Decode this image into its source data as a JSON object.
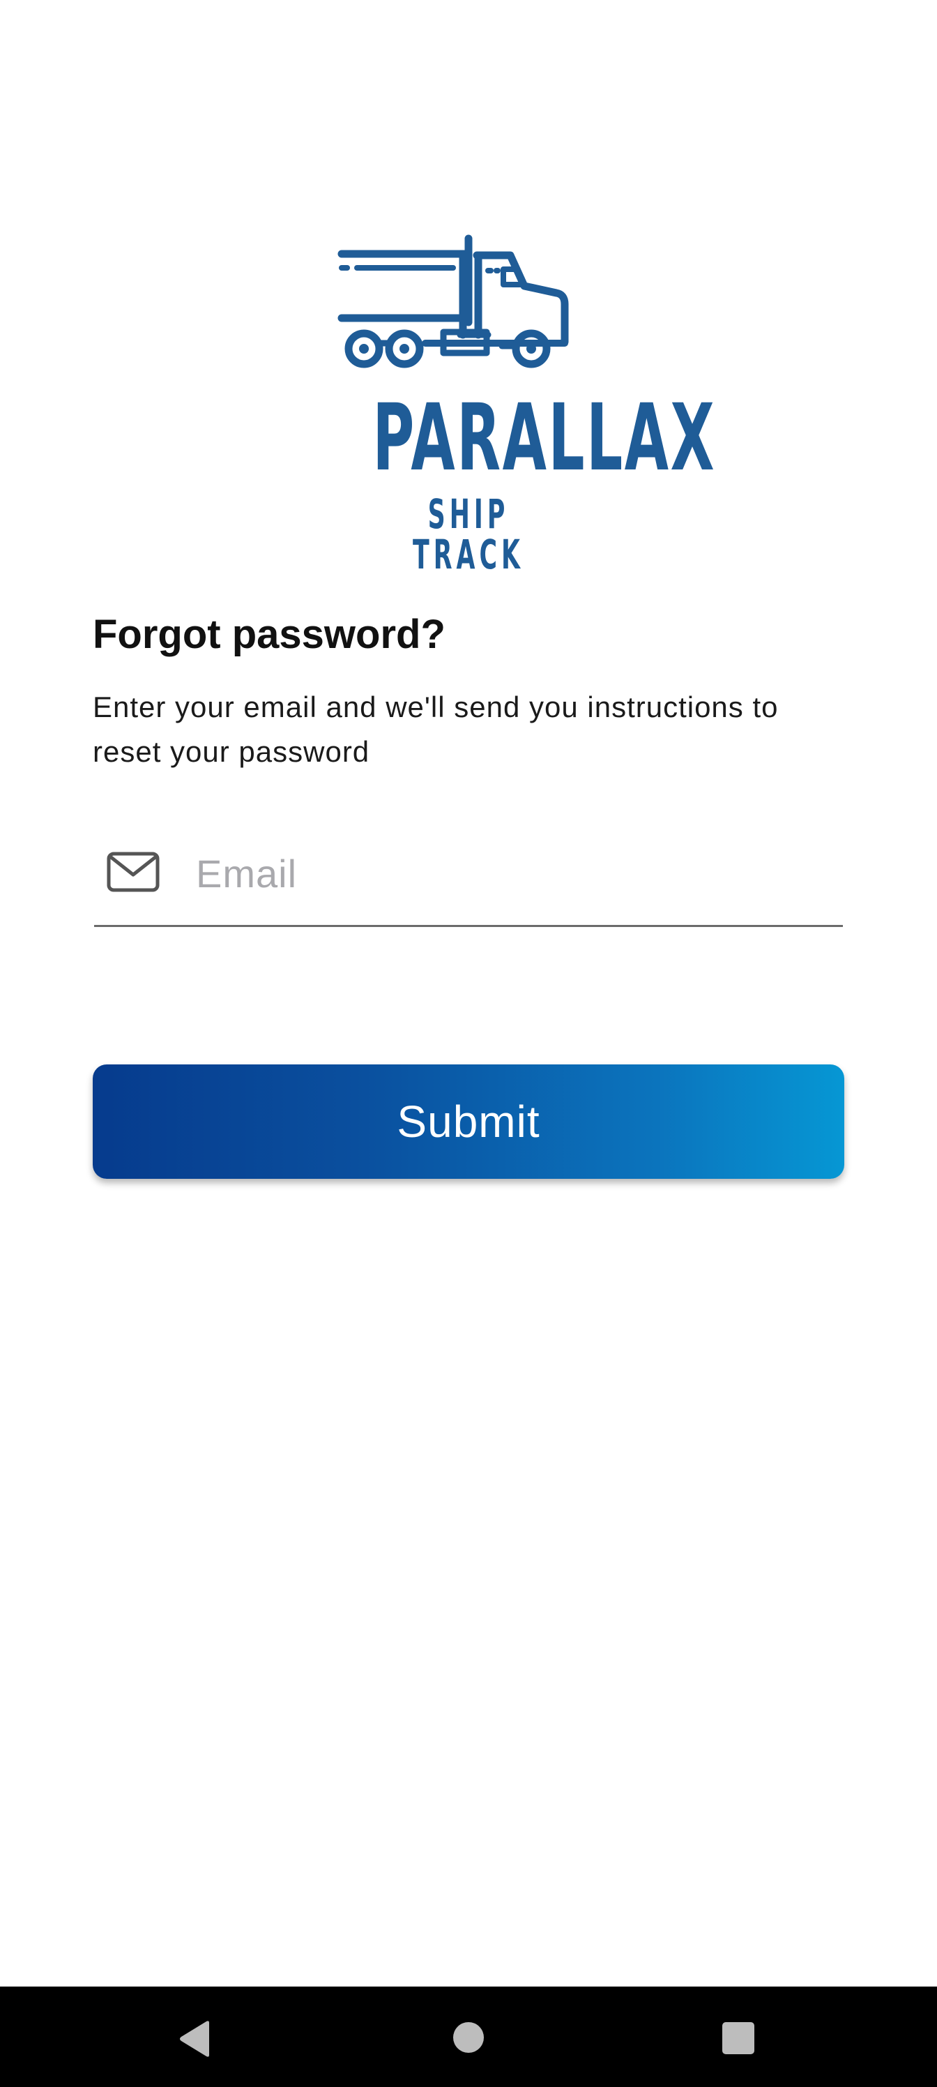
{
  "logo": {
    "brand_name": "PARALLAX",
    "brand_sub": "SHIP TRACK",
    "icon": "truck-logo",
    "color": "#1f5c97"
  },
  "form": {
    "title": "Forgot password?",
    "subtitle": "Enter your email and we'll send you instructions to reset your password",
    "email": {
      "icon": "mail-icon",
      "placeholder": "Email",
      "value": ""
    },
    "submit_label": "Submit",
    "submit_gradient": [
      "#063b8d",
      "#0697d4"
    ]
  },
  "navigation_bar": {
    "back_icon": "back-triangle-icon",
    "home_icon": "home-circle-icon",
    "recents_icon": "recents-square-icon"
  }
}
